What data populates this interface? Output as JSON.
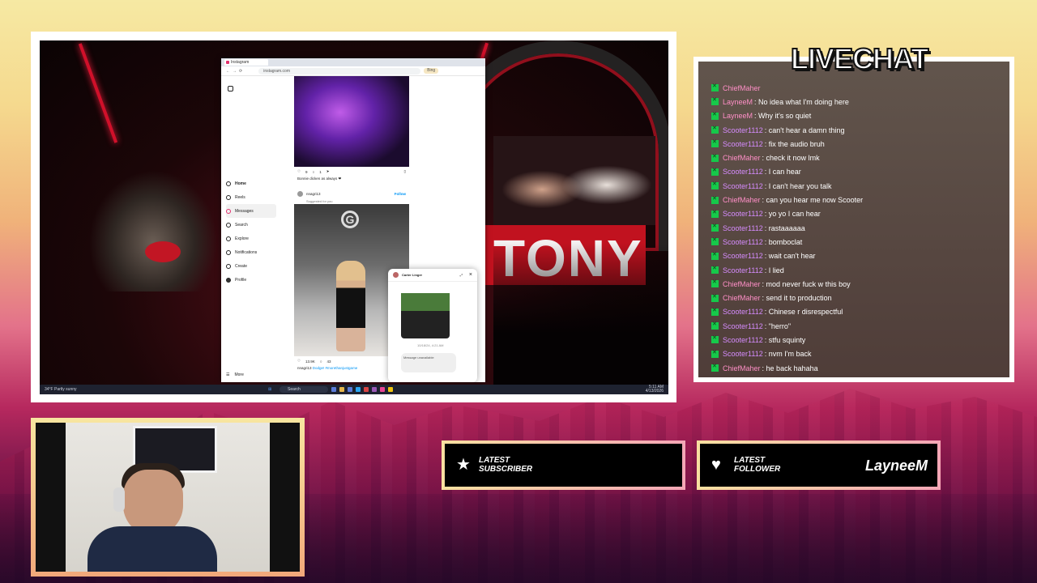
{
  "browser": {
    "tab_title": "Instagram",
    "url": "instagram.com",
    "ext_label": "Bing"
  },
  "instagram": {
    "nav": [
      {
        "label": "Home",
        "icon": "home-icon"
      },
      {
        "label": "Reels",
        "icon": "reels-icon"
      },
      {
        "label": "Messages",
        "icon": "messages-icon"
      },
      {
        "label": "Search",
        "icon": "search-icon"
      },
      {
        "label": "Explore",
        "icon": "explore-icon"
      },
      {
        "label": "Notifications",
        "icon": "heart-icon"
      },
      {
        "label": "Create",
        "icon": "plus-icon"
      },
      {
        "label": "Profile",
        "icon": "avatar-icon"
      }
    ],
    "more_label": "More",
    "post1": {
      "likes": "9",
      "comments": "1",
      "caption": "Bonnie dicken as always ❤"
    },
    "post2": {
      "user": "nnagri13",
      "follow": "Follow",
      "sub": "Suggested for you",
      "caption_user": "nnagri13",
      "caption_text": "Dodge! #morethanjustgame",
      "likes": "13.9K",
      "comments": "43"
    },
    "chat_popup": {
      "name": "Carter Linger",
      "timestamp": "10/18/24, 4:21 AM",
      "message": "Message unavailable"
    }
  },
  "taskbar": {
    "weather": "34°F Partly sunny",
    "search_placeholder": "Search",
    "time": "5:11 AM",
    "date": "4/13/2026"
  },
  "livechat": {
    "title": "LIVECHAT",
    "messages": [
      {
        "user": "ChiefMaher",
        "text": "",
        "color": "pink"
      },
      {
        "user": "LayneeM",
        "text": "No idea what I'm doing here",
        "color": "pink"
      },
      {
        "user": "LayneeM",
        "text": "Why it's so quiet",
        "color": "pink"
      },
      {
        "user": "Scooter1112",
        "text": "can't hear a damn thing",
        "color": "purple"
      },
      {
        "user": "Scooter1112",
        "text": "fix the audio bruh",
        "color": "purple"
      },
      {
        "user": "ChiefMaher",
        "text": "check it now lmk",
        "color": "pink"
      },
      {
        "user": "Scooter1112",
        "text": "I can hear",
        "color": "purple"
      },
      {
        "user": "Scooter1112",
        "text": "I can't hear you talk",
        "color": "purple"
      },
      {
        "user": "ChiefMaher",
        "text": "can you hear me now Scooter",
        "color": "pink"
      },
      {
        "user": "Scooter1112",
        "text": "yo yo I can hear",
        "color": "purple"
      },
      {
        "user": "Scooter1112",
        "text": "rastaaaaaa",
        "color": "purple"
      },
      {
        "user": "Scooter1112",
        "text": "bomboclat",
        "color": "purple"
      },
      {
        "user": "Scooter1112",
        "text": "wait can't hear",
        "color": "purple"
      },
      {
        "user": "Scooter1112",
        "text": "I lied",
        "color": "purple"
      },
      {
        "user": "ChiefMaher",
        "text": "mod never fuck w this boy",
        "color": "pink"
      },
      {
        "user": "ChiefMaher",
        "text": "send it to production",
        "color": "pink"
      },
      {
        "user": "Scooter1112",
        "text": "Chinese r disrespectful",
        "color": "purple"
      },
      {
        "user": "Scooter1112",
        "text": "\"herro\"",
        "color": "purple"
      },
      {
        "user": "Scooter1112",
        "text": "stfu squinty",
        "color": "purple"
      },
      {
        "user": "Scooter1112",
        "text": "nvm I'm back",
        "color": "purple"
      },
      {
        "user": "ChiefMaher",
        "text": "he back hahaha",
        "color": "pink"
      }
    ]
  },
  "latest_subscriber": {
    "line1": "Latest",
    "line2": "Subscriber",
    "value": "",
    "icon": "star-icon"
  },
  "latest_follower": {
    "line1": "Latest",
    "line2": "Follower",
    "value": "LayneeM",
    "icon": "heart-icon"
  },
  "stage": {
    "banner_text": "TONY"
  },
  "colors": {
    "accent_green": "#16c94a",
    "user_pink": "#ff8fc7",
    "user_purple": "#d68cff"
  }
}
